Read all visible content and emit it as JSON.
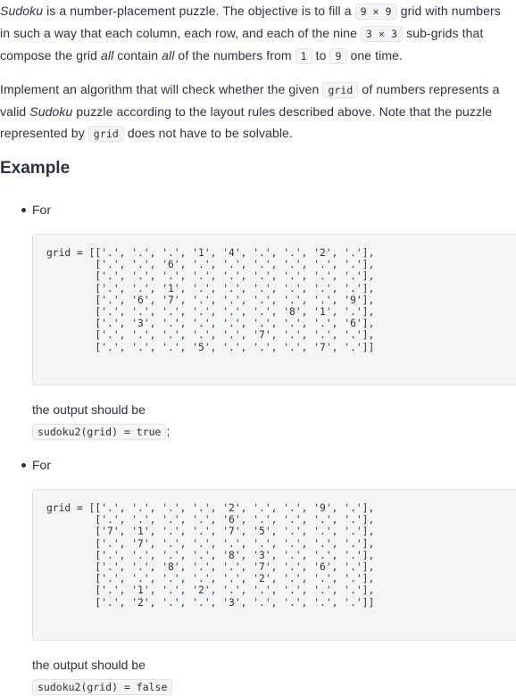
{
  "paragraph1": {
    "sudoku_word": "Sudoku",
    "t1": " is a number-placement puzzle. The objective is to fill a ",
    "code_9x9": "9 × 9",
    "t2": " grid with numbers in such a way that each column, each row, and each of the nine ",
    "code_3x3": "3 × 3",
    "t3": " sub-grids that compose the grid ",
    "all1": "all",
    "t4": " contain ",
    "all2": "all",
    "t5": " of the numbers from ",
    "code_1": "1",
    "t6": " to ",
    "code_9": "9",
    "t7": " one time."
  },
  "paragraph2": {
    "t1": "Implement an algorithm that will check whether the given ",
    "code_grid1": "grid",
    "t2": " of numbers represents a valid ",
    "sudoku_word": "Sudoku",
    "t3": " puzzle according to the layout rules described above. Note that the puzzle represented by ",
    "code_grid2": "grid",
    "t4": " does not have to be solvable."
  },
  "example_heading": "Example",
  "examples": [
    {
      "for_label": "For",
      "code": "grid = [['.', '.', '.', '1', '4', '.', '.', '2', '.'],\n        ['.', '.', '6', '.', '.', '.', '.', '.', '.'],\n        ['.', '.', '.', '.', '.', '.', '.', '.', '.'],\n        ['.', '.', '1', '.', '.', '.', '.', '.', '.'],\n        ['.', '6', '7', '.', '.', '.', '.', '.', '9'],\n        ['.', '.', '.', '.', '.', '.', '8', '1', '.'],\n        ['.', '3', '.', '.', '.', '.', '.', '.', '6'],\n        ['.', '.', '.', '.', '.', '7', '.', '.', '.'],\n        ['.', '.', '.', '5', '.', '.', '.', '7', '.']]",
      "output_label": "the output should be",
      "output_value": "sudoku2(grid) = true",
      "output_suffix": ";"
    },
    {
      "for_label": "For",
      "code": "grid = [['.', '.', '.', '.', '2', '.', '.', '9', '.'],\n        ['.', '.', '.', '.', '6', '.', '.', '.', '.'],\n        ['7', '1', '.', '.', '7', '5', '.', '.', '.'],\n        ['.', '7', '.', '.', '.', '.', '.', '.', '.'],\n        ['.', '.', '.', '.', '8', '3', '.', '.', '.'],\n        ['.', '.', '8', '.', '.', '7', '.', '6', '.'],\n        ['.', '.', '.', '.', '.', '2', '.', '.', '.'],\n        ['.', '1', '.', '2', '.', '.', '.', '.', '.'],\n        ['.', '2', '.', '.', '3', '.', '.', '.', '.']]",
      "output_label": "the output should be",
      "output_value": "sudoku2(grid) = false"
    }
  ]
}
